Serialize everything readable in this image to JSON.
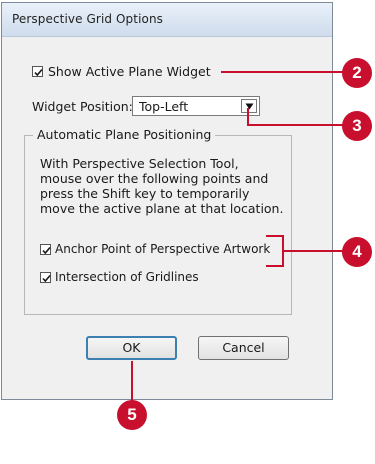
{
  "dialog": {
    "title": "Perspective Grid Options",
    "show_widget_label": "Show Active Plane Widget",
    "widget_position_label": "Widget Position:",
    "widget_position_value": "Top-Left",
    "group_title": "Automatic Plane Positioning",
    "description_lines": [
      "With Perspective Selection Tool,",
      "mouse over the following points and",
      "press the Shift key to temporarily",
      "move the active plane at that location."
    ],
    "anchor_point_label": "Anchor Point of Perspective Artwork",
    "intersection_label": "Intersection of Gridlines",
    "ok_label": "OK",
    "cancel_label": "Cancel"
  },
  "callouts": [
    "2",
    "3",
    "4",
    "5"
  ],
  "colors": {
    "callout": "#c8102e",
    "default_button_border": "#3c7fb1"
  },
  "icons": {
    "checkbox_mark": "checkmark-icon",
    "dropdown": "triangle-down-icon"
  }
}
